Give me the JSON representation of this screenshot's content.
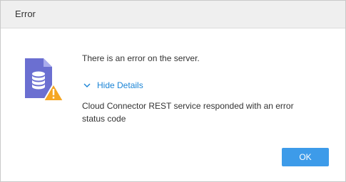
{
  "dialog": {
    "title": "Error",
    "message": "There is an error on the server.",
    "toggle_label": "Hide Details",
    "details": "Cloud Connector REST service responded with an error status code",
    "ok_label": "OK"
  },
  "icons": {
    "main": "database-document-icon",
    "warning": "warning-triangle-icon",
    "toggle": "chevron-down-icon"
  },
  "colors": {
    "document": "#6b6fd1",
    "warning": "#f5a623",
    "link": "#1a84d6",
    "button": "#3d9be9"
  }
}
